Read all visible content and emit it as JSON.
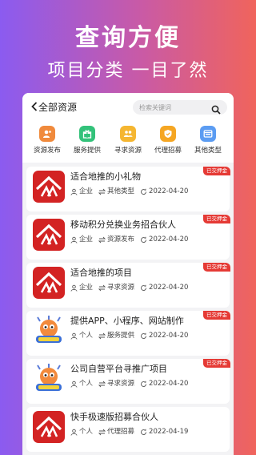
{
  "hero": {
    "title": "查询方便",
    "subtitle": "项目分类 一目了然"
  },
  "header": {
    "back_icon": "chevron-left-icon",
    "title": "全部资源",
    "search_placeholder": "检索关键词",
    "search_icon": "search-icon"
  },
  "categories": [
    {
      "label": "资源发布",
      "icon": "user-publish-icon",
      "color": "#f08a3c"
    },
    {
      "label": "服务提供",
      "icon": "gift-icon",
      "color": "#33c27a"
    },
    {
      "label": "寻求资源",
      "icon": "people-search-icon",
      "color": "#f5b631"
    },
    {
      "label": "代理招募",
      "icon": "shield-check-icon",
      "color": "#f5a623"
    },
    {
      "label": "其他类型",
      "icon": "window-icon",
      "color": "#5b9cf2"
    }
  ],
  "items": [
    {
      "title": "适合地推的小礼物",
      "badge": "已交押金",
      "user_type": "企业",
      "category": "其他类型",
      "date": "2022-04-20",
      "logo": "red-mountain-logo"
    },
    {
      "title": "移动积分兑换业务招合伙人",
      "badge": "已交押金",
      "user_type": "企业",
      "category": "资源发布",
      "date": "2022-04-20",
      "logo": "red-mountain-logo"
    },
    {
      "title": "适合地推的项目",
      "badge": "已交押金",
      "user_type": "企业",
      "category": "寻求资源",
      "date": "2022-04-20",
      "logo": "red-mountain-logo"
    },
    {
      "title": "提供APP、小程序、网站制作",
      "badge": "已交押金",
      "user_type": "个人",
      "category": "服务提供",
      "date": "2022-04-20",
      "logo": "cartoon-mascot-logo"
    },
    {
      "title": "公司自营平台寻推广项目",
      "badge": "已交押金",
      "user_type": "个人",
      "category": "寻求资源",
      "date": "2022-04-20",
      "logo": "cartoon-mascot-logo"
    },
    {
      "title": "快手极速版招募合伙人",
      "badge": "",
      "user_type": "个人",
      "category": "代理招募",
      "date": "2022-04-19",
      "logo": "red-mountain-logo"
    }
  ],
  "meta_icons": {
    "user": "person-icon",
    "category": "swap-arrows-icon",
    "date": "refresh-clock-icon"
  }
}
